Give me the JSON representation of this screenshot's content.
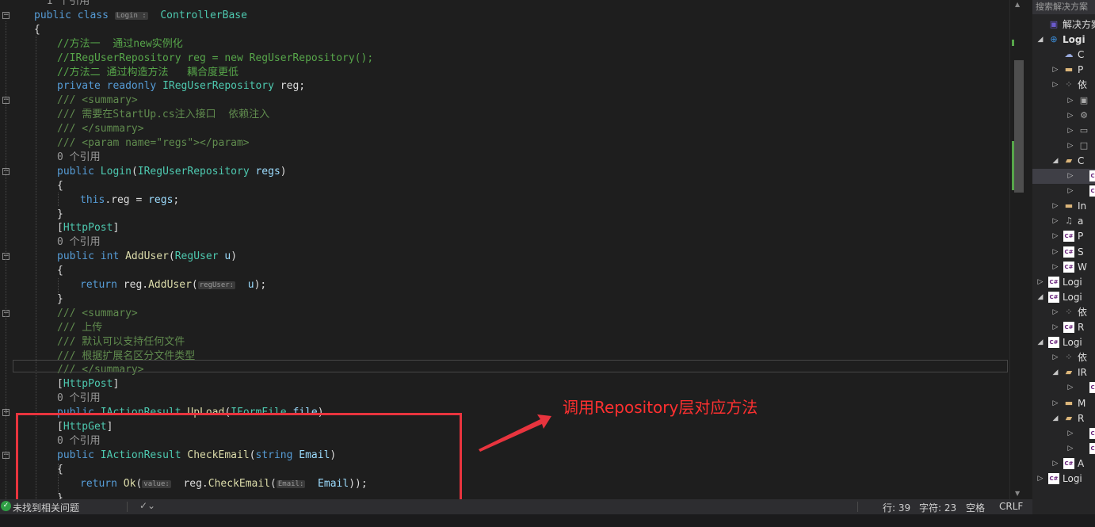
{
  "editor": {
    "lines": [
      {
        "code": "  1 个引用",
        "indent": 1
      },
      {
        "code": "public class Login : ControllerBase",
        "indent": 1
      },
      {
        "code": "{",
        "indent": 1
      },
      {
        "code": "//方法一  通过new实例化",
        "indent": 2
      },
      {
        "code": "//IRegUserRepository reg = new RegUserRepository();",
        "indent": 2
      },
      {
        "code": "//方法二 通过构造方法   耦合度更低",
        "indent": 2
      },
      {
        "code": "private readonly IRegUserRepository reg;",
        "indent": 2
      },
      {
        "code": "/// <summary>",
        "indent": 2
      },
      {
        "code": "/// 需要在StartUp.cs注入接口  依赖注入",
        "indent": 2
      },
      {
        "code": "/// </summary>",
        "indent": 2
      },
      {
        "code": "/// <param name=\"regs\"></param>",
        "indent": 2
      },
      {
        "code": "0 个引用",
        "indent": 2
      },
      {
        "code": "public Login(IRegUserRepository regs)",
        "indent": 2
      },
      {
        "code": "{",
        "indent": 2
      },
      {
        "code": "this.reg = regs;",
        "indent": 3
      },
      {
        "code": "}",
        "indent": 2
      },
      {
        "code": "[HttpPost]",
        "indent": 2
      },
      {
        "code": "0 个引用",
        "indent": 2
      },
      {
        "code": "public int AddUser(RegUser u)",
        "indent": 2
      },
      {
        "code": "{",
        "indent": 2
      },
      {
        "code": "return reg.AddUser(regUser: u);",
        "indent": 3
      },
      {
        "code": "}",
        "indent": 2
      },
      {
        "code": "/// <summary>",
        "indent": 2
      },
      {
        "code": "/// 上传",
        "indent": 2
      },
      {
        "code": "/// 默认可以支持任何文件",
        "indent": 2
      },
      {
        "code": "/// 根据扩展名区分文件类型",
        "indent": 2
      },
      {
        "code": "/// </summary>",
        "indent": 2
      },
      {
        "code": "[HttpPost]",
        "indent": 2
      },
      {
        "code": "0 个引用",
        "indent": 2
      },
      {
        "code": "public IActionResult UpLoad(IFormFile file) ...",
        "indent": 2
      },
      {
        "code": "[HttpGet]",
        "indent": 2
      },
      {
        "code": "0 个引用",
        "indent": 2
      },
      {
        "code": "public IActionResult CheckEmail(string Email)",
        "indent": 2
      },
      {
        "code": "{",
        "indent": 2
      },
      {
        "code": "return Ok(value: reg.CheckEmail(Email: Email));",
        "indent": 3
      },
      {
        "code": "}",
        "indent": 2
      }
    ],
    "annotation": "调用Repository层对应方法",
    "vscroll_position": 0.24
  },
  "status": {
    "issues": "未找到相关问题",
    "line": "行: 39",
    "char": "字符: 23",
    "whitespace": "空格",
    "eol": "CRLF"
  },
  "explorer": {
    "search_placeholder": "搜索解决方案",
    "items": [
      {
        "label": "解决方案",
        "depth": 0,
        "arrow": "",
        "icon": "vs-solution-icon"
      },
      {
        "label": "Logi",
        "depth": 0,
        "arrow": "◢",
        "icon": "web-project-icon",
        "bold": true
      },
      {
        "label": "C",
        "depth": 1,
        "arrow": "",
        "icon": "connected-services-icon"
      },
      {
        "label": "P",
        "depth": 1,
        "arrow": "▷",
        "icon": "properties-folder-icon"
      },
      {
        "label": "依",
        "depth": 1,
        "arrow": "▷",
        "icon": "dependencies-icon"
      },
      {
        "label": "",
        "depth": 2,
        "arrow": "▷",
        "icon": "package-icon"
      },
      {
        "label": "",
        "depth": 2,
        "arrow": "▷",
        "icon": "analyzer-icon"
      },
      {
        "label": "",
        "depth": 2,
        "arrow": "▷",
        "icon": "framework-icon"
      },
      {
        "label": "",
        "depth": 2,
        "arrow": "▷",
        "icon": "project-ref-icon"
      },
      {
        "label": "C",
        "depth": 1,
        "arrow": "◢",
        "icon": "folder-open-icon"
      },
      {
        "label": "C#",
        "depth": 2,
        "arrow": "▷",
        "icon": "cs-file-icon",
        "selected": true
      },
      {
        "label": "C#",
        "depth": 2,
        "arrow": "▷",
        "icon": "cs-file-icon"
      },
      {
        "label": "In",
        "depth": 1,
        "arrow": "▷",
        "icon": "folder-icon"
      },
      {
        "label": "a",
        "depth": 1,
        "arrow": "▷",
        "icon": "json-file-icon"
      },
      {
        "label": "P",
        "depth": 1,
        "arrow": "▷",
        "icon": "cs-file-icon"
      },
      {
        "label": "S",
        "depth": 1,
        "arrow": "▷",
        "icon": "cs-file-icon"
      },
      {
        "label": "W",
        "depth": 1,
        "arrow": "▷",
        "icon": "cs-file-icon"
      },
      {
        "label": "Logi",
        "depth": 0,
        "arrow": "▷",
        "icon": "cs-project-icon"
      },
      {
        "label": "Logi",
        "depth": 0,
        "arrow": "◢",
        "icon": "cs-project-icon"
      },
      {
        "label": "依",
        "depth": 1,
        "arrow": "▷",
        "icon": "dependencies-icon"
      },
      {
        "label": "R",
        "depth": 1,
        "arrow": "▷",
        "icon": "cs-file-icon"
      },
      {
        "label": "Logi",
        "depth": 0,
        "arrow": "◢",
        "icon": "cs-project-icon"
      },
      {
        "label": "依",
        "depth": 1,
        "arrow": "▷",
        "icon": "dependencies-icon"
      },
      {
        "label": "IR",
        "depth": 1,
        "arrow": "◢",
        "icon": "folder-open-icon"
      },
      {
        "label": "C#",
        "depth": 2,
        "arrow": "▷",
        "icon": "cs-file-icon"
      },
      {
        "label": "M",
        "depth": 1,
        "arrow": "▷",
        "icon": "folder-icon"
      },
      {
        "label": "R",
        "depth": 1,
        "arrow": "◢",
        "icon": "folder-open-icon"
      },
      {
        "label": "C#",
        "depth": 2,
        "arrow": "▷",
        "icon": "cs-file-icon"
      },
      {
        "label": "C#",
        "depth": 2,
        "arrow": "▷",
        "icon": "cs-file-icon"
      },
      {
        "label": "A",
        "depth": 1,
        "arrow": "▷",
        "icon": "cs-file-icon"
      },
      {
        "label": "Logi",
        "depth": 0,
        "arrow": "▷",
        "icon": "cs-project-icon"
      }
    ]
  }
}
